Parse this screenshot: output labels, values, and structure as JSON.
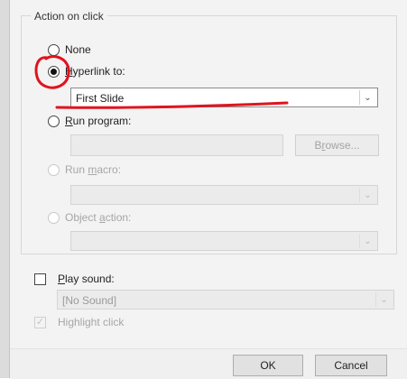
{
  "group": {
    "legend": "Action on click"
  },
  "options": {
    "none": {
      "label": "None"
    },
    "hyperlink": {
      "label_key": "H",
      "label_rest": "yperlink to:",
      "selected": true
    },
    "hyperlink_target": {
      "value": "First Slide"
    },
    "run_program": {
      "label_key": "R",
      "label_rest": "un program:"
    },
    "browse_button": {
      "label_pre": "B",
      "label_key": "r",
      "label_rest": "owse..."
    },
    "run_macro": {
      "label_pre": "Run ",
      "label_key": "m",
      "label_rest": "acro:"
    },
    "object_action": {
      "label_pre": "Object ",
      "label_key": "a",
      "label_rest": "ction:"
    }
  },
  "sound": {
    "label_key": "P",
    "label_rest": "lay sound:",
    "value": "[No Sound]"
  },
  "highlight": {
    "label": "Highlight click"
  },
  "buttons": {
    "ok": "OK",
    "cancel": "Cancel"
  },
  "colors": {
    "annotation": "#e0141e",
    "dialog_bg": "#f3f3f3"
  }
}
